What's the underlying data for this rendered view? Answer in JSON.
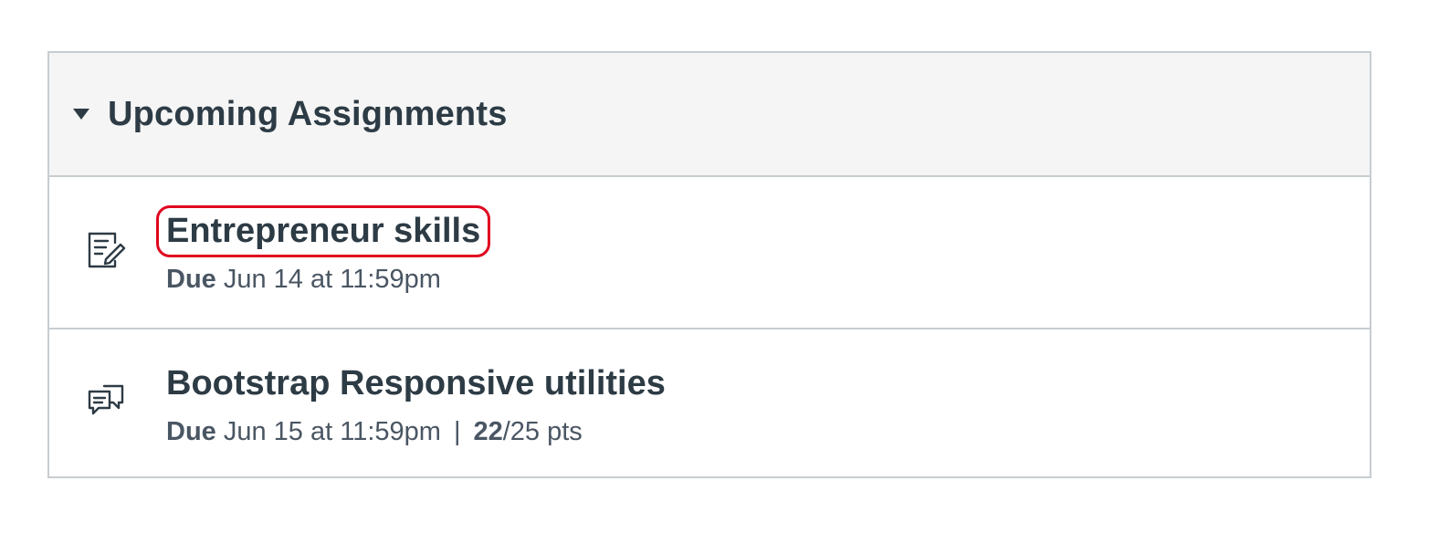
{
  "header": {
    "title": "Upcoming Assignments",
    "toggle_icon": "caret-down-icon"
  },
  "items": [
    {
      "icon": "assignment-icon",
      "title": "Entrepreneur skills",
      "due_label": "Due",
      "due_date": "Jun 14 at 11:59pm"
    },
    {
      "icon": "discussion-icon",
      "title": "Bootstrap Responsive utilities",
      "due_label": "Due",
      "due_date": "Jun 15 at 11:59pm",
      "separator": "|",
      "score": "22",
      "points_possible": "/25 pts"
    }
  ],
  "colors": {
    "highlight": "#e0061f",
    "text": "#2d3b45",
    "border": "#c7cdd1",
    "header_bg": "#f5f5f5"
  }
}
